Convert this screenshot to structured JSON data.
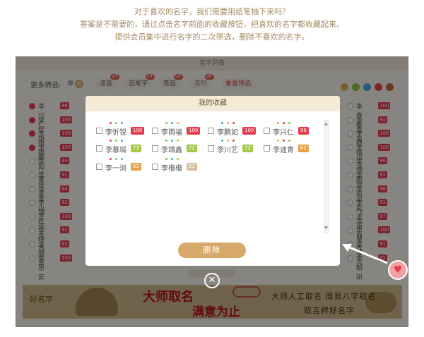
{
  "intro": {
    "line1": "对于喜欢的名字，我们需要用纸笔抽下来吗？",
    "line2": "答案是不需要的，通过点击名字前面的收藏按钮，把喜欢的名字都收藏起来。",
    "line3": "提供会员集中进行名字的二次筛选，删除不喜欢的名字。"
  },
  "app": {
    "title": "名字列表",
    "filter_label": "更多筛选:",
    "filters": [
      {
        "label": "单",
        "badge": "双",
        "tag": ""
      },
      {
        "label": "读音",
        "tag": "VIP"
      },
      {
        "label": "首尾字",
        "tag": "VIP"
      },
      {
        "label": "笔画",
        "tag": "VIP"
      },
      {
        "label": "五行",
        "tag": "VIP"
      },
      {
        "label": "重置筛选",
        "tag": ""
      }
    ],
    "element_dots": [
      {
        "name": "metal",
        "color": "#d8b24a"
      },
      {
        "name": "wood",
        "color": "#8cc43e"
      },
      {
        "name": "water",
        "color": "#4aa8d8"
      },
      {
        "name": "fire",
        "color": "#e24a3c"
      },
      {
        "name": "earth",
        "color": "#b86a3c"
      }
    ],
    "left_column": [
      {
        "name": "李兴仁",
        "score": "96",
        "fav": true
      },
      {
        "name": "李忻锐",
        "score": "100",
        "fav": true
      },
      {
        "name": "李雨福",
        "score": "100",
        "fav": true
      },
      {
        "name": "李鹏如",
        "score": "100",
        "fav": true
      },
      {
        "name": "李江真",
        "score": "93",
        "fav": false
      },
      {
        "name": "李奇睿",
        "score": "91",
        "fav": false
      },
      {
        "name": "李青山",
        "score": "94",
        "fav": false
      },
      {
        "name": "李瑞社",
        "score": "92",
        "fav": false
      },
      {
        "name": "李崇亮",
        "score": "100",
        "fav": false
      },
      {
        "name": "李晓芮",
        "score": "91",
        "fav": false
      },
      {
        "name": "李顺翠",
        "score": "91",
        "fav": false
      },
      {
        "name": "李思安",
        "score": "100",
        "fav": false
      }
    ],
    "right_column": [
      {
        "name": "李春敏",
        "score": "100"
      },
      {
        "name": "李青帛",
        "score": "91"
      },
      {
        "name": "李静晴",
        "score": "100"
      },
      {
        "name": "李润泽",
        "score": "100"
      },
      {
        "name": "李瑞鹏",
        "score": "96"
      },
      {
        "name": "李瑞凯",
        "score": "91"
      },
      {
        "name": "李凤武",
        "score": "96"
      },
      {
        "name": "李飞鸿",
        "score": "91"
      },
      {
        "name": "李南西",
        "score": "97"
      },
      {
        "name": "李昊霖",
        "score": "100"
      },
      {
        "name": "李景兴",
        "score": "91"
      },
      {
        "name": "李朝阳",
        "score": "91"
      }
    ]
  },
  "modal": {
    "title": "我的收藏",
    "favorites": [
      {
        "name": "李忻锐",
        "score": "100",
        "color": "#e23d4e"
      },
      {
        "name": "李雨福",
        "score": "100",
        "color": "#e23d4e"
      },
      {
        "name": "李鹏如",
        "score": "100",
        "color": "#e23d4e"
      },
      {
        "name": "李兴仁",
        "score": "96",
        "color": "#e23d4e"
      },
      {
        "name": "李慕瑶",
        "score": "73",
        "color": "#a6c94a"
      },
      {
        "name": "李靖鑫",
        "score": "72",
        "color": "#a6c94a"
      },
      {
        "name": "李川艺",
        "score": "72",
        "color": "#a6c94a"
      },
      {
        "name": "李迪青",
        "score": "62",
        "color": "#e8a34a"
      },
      {
        "name": "李一浏",
        "score": "62",
        "color": "#e8a34a"
      },
      {
        "name": "李楷楷",
        "score": "53",
        "color": "#d3c29c"
      }
    ],
    "delete_label": "删除"
  },
  "close_glyph": "✕",
  "heart_glyph": "♥",
  "banner": {
    "logo": "好名字",
    "slogan1": "大师取名",
    "slogan2": "满意为止",
    "slogan3": "大师人工取名 周易八字取名",
    "slogan4": "取吉祥好名字"
  }
}
